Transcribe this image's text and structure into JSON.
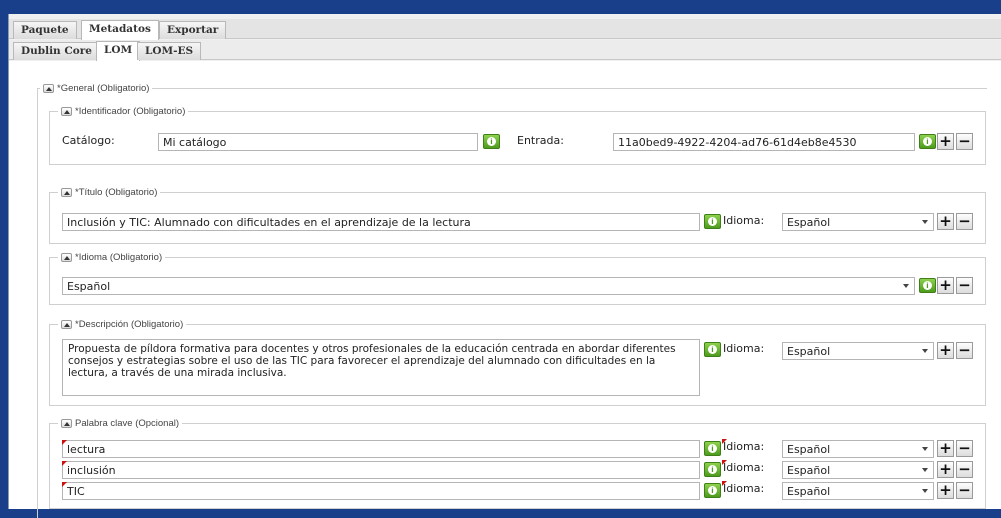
{
  "tabs_top": [
    "Paquete",
    "Metadatos",
    "Exportar"
  ],
  "tabs_sub": [
    "Dublin Core",
    "LOM",
    "LOM-ES"
  ],
  "general": {
    "legend": "*General (Obligatorio)"
  },
  "identificador": {
    "legend": "*Identificador (Obligatorio)",
    "catalogo_label": "Catálogo:",
    "catalogo_value": "Mi catálogo",
    "entrada_label": "Entrada:",
    "entrada_value": "11a0bed9-4922-4204-ad76-61d4eb8e4530"
  },
  "titulo": {
    "legend": "*Título (Obligatorio)",
    "value": "Inclusión y TIC: Alumnado con dificultades en el aprendizaje de la lectura",
    "idioma_label": "Idioma:",
    "idioma_value": "Español"
  },
  "idioma": {
    "legend": "*Idioma (Obligatorio)",
    "value": "Español"
  },
  "descripcion": {
    "legend": "*Descripción (Obligatorio)",
    "value": "Propuesta de píldora formativa para docentes y otros profesionales de la educación centrada en abordar diferentes consejos y estrategias sobre el uso de las TIC para favorecer el aprendizaje del alumnado con dificultades en la lectura, a través de una mirada inclusiva.",
    "idioma_label": "Idioma:",
    "idioma_value": "Español"
  },
  "palabra_clave": {
    "legend": "Palabra clave (Opcional)",
    "rows": [
      {
        "value": "lectura",
        "idioma_label": "Idioma:",
        "idioma_value": "Español"
      },
      {
        "value": "inclusión",
        "idioma_label": "Idioma:",
        "idioma_value": "Español"
      },
      {
        "value": "TIC",
        "idioma_label": "Idioma:",
        "idioma_value": "Español"
      }
    ]
  },
  "icons": {
    "info": "info-icon",
    "add": "plus-icon",
    "remove": "minus-icon",
    "toggle": "collapse-icon"
  },
  "colors": {
    "frame": "#1a3f8a",
    "info_green": "#5aa82a",
    "required_marker": "#cc1111"
  }
}
